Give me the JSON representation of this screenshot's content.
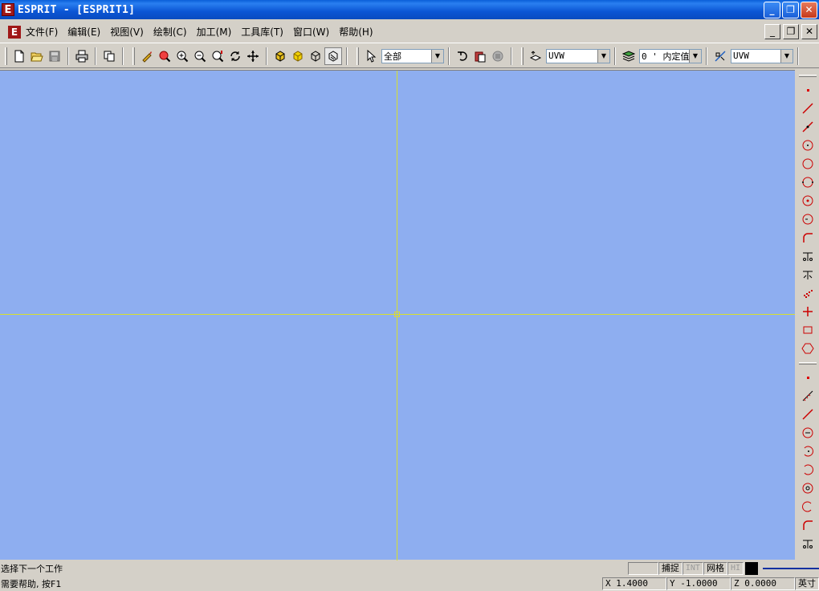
{
  "window": {
    "title": "ESPRIT - [ESPRIT1]",
    "logo_letter": "E"
  },
  "menu": [
    {
      "label": "文件(F)"
    },
    {
      "label": "编辑(E)"
    },
    {
      "label": "视图(V)"
    },
    {
      "label": "绘制(C)"
    },
    {
      "label": "加工(M)"
    },
    {
      "label": "工具库(T)"
    },
    {
      "label": "窗口(W)"
    },
    {
      "label": "帮助(H)"
    }
  ],
  "toolbar": {
    "select_filter": "全部",
    "work_plane": "UVW",
    "layer": "0 ' 内定值'",
    "view_plane": "UVW"
  },
  "canvas": {
    "background": "#8eaef0",
    "axis_color": "#d8e02a"
  },
  "status": {
    "prompt": "选择下一个工作",
    "help": "需要帮助, 按F1",
    "snap": "捕捉",
    "int": "INT",
    "grid": "网格",
    "hi": "HI",
    "x": "X 1.4000",
    "y": "Y -1.0000",
    "z": "Z 0.0000",
    "units": "英寸"
  }
}
